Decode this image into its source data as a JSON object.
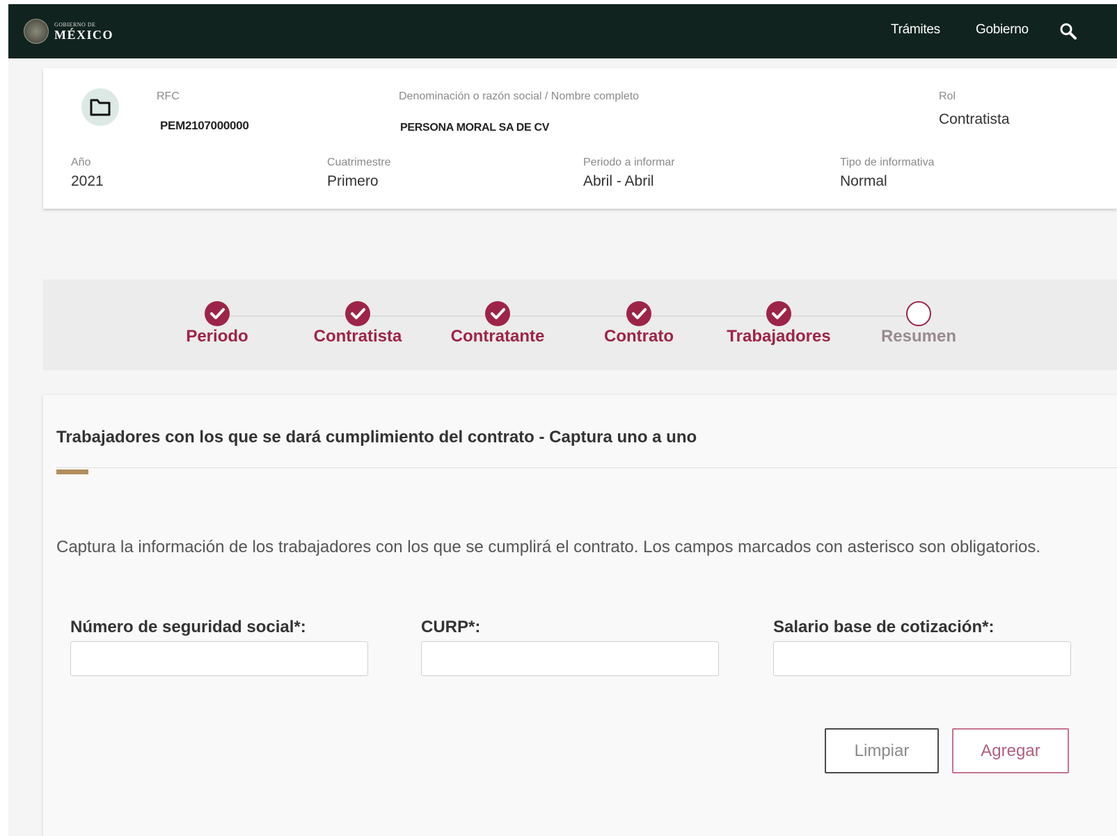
{
  "header": {
    "logo_small": "GOBIERNO DE",
    "logo_big": "MÉXICO",
    "nav": [
      "Trámites",
      "Gobierno"
    ],
    "icons": {
      "logo": "coat-of-arms-icon",
      "search": "search-icon"
    }
  },
  "info": {
    "icon": "folder-icon",
    "rfc_label": "RFC",
    "rfc_value": "PEM2107000000",
    "name_label": "Denominación o razón social / Nombre completo",
    "name_value": "PERSONA MORAL SA DE CV",
    "rol_label": "Rol",
    "rol_value": "Contratista",
    "year_label": "Año",
    "year_value": "2021",
    "cuatri_label": "Cuatrimestre",
    "cuatri_value": "Primero",
    "periodo_label": "Periodo a informar",
    "periodo_value": "Abril - Abril",
    "tipo_label": "Tipo de informativa",
    "tipo_value": "Normal"
  },
  "stepper": {
    "steps": [
      {
        "label": "Periodo",
        "status": "completed"
      },
      {
        "label": "Contratista",
        "status": "completed"
      },
      {
        "label": "Contratante",
        "status": "completed"
      },
      {
        "label": "Contrato",
        "status": "completed"
      },
      {
        "label": "Trabajadores",
        "status": "completed"
      },
      {
        "label": "Resumen",
        "status": "pending"
      }
    ],
    "icons": {
      "completed": "check-circle-icon",
      "pending": "empty-circle-icon"
    }
  },
  "form": {
    "title": "Trabajadores con los que se dará cumplimiento del contrato - Captura uno a uno",
    "instructions": "Captura la información de los trabajadores con los que se cumplirá el contrato. Los campos marcados con asterisco son obligatorios.",
    "fields": [
      {
        "label": "Número de seguridad social*:",
        "value": ""
      },
      {
        "label": "CURP*:",
        "value": ""
      },
      {
        "label": "Salario base de cotización*:",
        "value": ""
      }
    ],
    "clear_label": "Limpiar",
    "add_label": "Agregar"
  },
  "colors": {
    "header_bg": "#10231e",
    "accent": "#9d2449",
    "gold": "#b38e5d",
    "folder_circle": "#dce9e5"
  }
}
